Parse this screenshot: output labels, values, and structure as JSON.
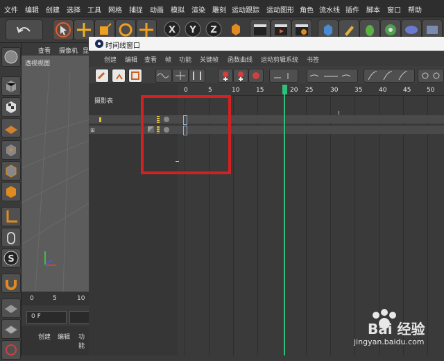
{
  "menubar": {
    "items": [
      "文件",
      "编辑",
      "创建",
      "选择",
      "工具",
      "网格",
      "捕捉",
      "动画",
      "模拟",
      "渲染",
      "雕刻",
      "运动跟踪",
      "运动图形",
      "角色",
      "流水线",
      "插件",
      "脚本",
      "窗口",
      "帮助"
    ]
  },
  "viewport": {
    "menu": [
      "查看",
      "摄像机",
      "显"
    ],
    "title": "透视视图",
    "ruler_ticks": [
      "0",
      "5",
      "10"
    ],
    "frame_value": "0 F",
    "tabs": [
      "创建",
      "编辑",
      "功能"
    ]
  },
  "timeline_window": {
    "title": "时间线窗口",
    "menu": [
      "创建",
      "编辑",
      "查看",
      "帧",
      "功能",
      "关键帧",
      "函数曲线",
      "运动剪辑系统",
      "书签"
    ],
    "left_header": "摄影表",
    "ruler_ticks": [
      "0",
      "5",
      "10",
      "15",
      "20",
      "25",
      "30",
      "35",
      "40",
      "45",
      "50"
    ],
    "playhead_frame": 20
  },
  "colors": {
    "playhead": "#2fbf7a",
    "highlight": "#d42020",
    "window_bg": "#3c3c3c"
  },
  "watermark": {
    "text": "Bai 经验",
    "url": "jingyan.baidu.com"
  }
}
